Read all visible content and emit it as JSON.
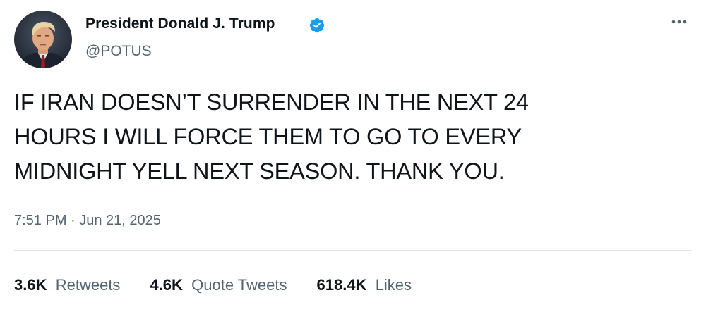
{
  "author": {
    "display_name": "President Donald J. Trump",
    "handle": "@POTUS",
    "verified": true,
    "avatar_icon": "profile-photo",
    "verified_icon": "verified-badge-icon",
    "verified_color": "#1d9bf0"
  },
  "menu": {
    "more_icon": "more-options-icon"
  },
  "tweet": {
    "text_lines": [
      "IF IRAN DOESN’T SURRENDER IN THE NEXT 24",
      "HOURS I WILL FORCE THEM TO GO TO EVERY",
      "MIDNIGHT YELL NEXT SEASON. THANK YOU."
    ],
    "timestamp": "7:51 PM · Jun 21, 2025"
  },
  "stats": {
    "retweets": {
      "count": "3.6K",
      "label": "Retweets"
    },
    "quote_tweets": {
      "count": "4.6K",
      "label": "Quote Tweets"
    },
    "likes": {
      "count": "618.4K",
      "label": "Likes"
    }
  },
  "colors": {
    "text_primary": "#0f1419",
    "text_secondary": "#536471",
    "divider": "#e1e5e8"
  }
}
